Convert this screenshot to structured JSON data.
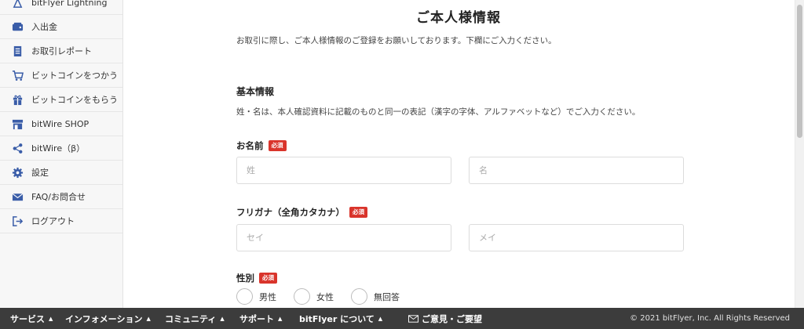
{
  "sidebar": {
    "items": [
      {
        "label": "bitFlyer Lightning",
        "icon": "lightning-icon"
      },
      {
        "label": "入出金",
        "icon": "wallet-icon"
      },
      {
        "label": "お取引レポート",
        "icon": "report-icon"
      },
      {
        "label": "ビットコインをつかう",
        "icon": "cart-icon"
      },
      {
        "label": "ビットコインをもらう",
        "icon": "gift-icon"
      },
      {
        "label": "bitWire SHOP",
        "icon": "shop-icon"
      },
      {
        "label": "bitWire（β）",
        "icon": "share-icon"
      },
      {
        "label": "設定",
        "icon": "gear-icon"
      },
      {
        "label": "FAQ/お問合せ",
        "icon": "mail-icon"
      },
      {
        "label": "ログアウト",
        "icon": "logout-icon"
      }
    ]
  },
  "main": {
    "title": "ご本人様情報",
    "lead": "お取引に際し、ご本人様情報のご登録をお願いしております。下欄にご入力ください。",
    "basic": {
      "title": "基本情報",
      "note": "姓・名は、本人確認資料に記載のものと同一の表記（漢字の字体、アルファベットなど）でご入力ください。"
    },
    "name": {
      "label": "お名前",
      "required": "必須",
      "last_placeholder": "姓",
      "first_placeholder": "名"
    },
    "kana": {
      "label": "フリガナ（全角カタカナ）",
      "required": "必須",
      "last_placeholder": "セイ",
      "first_placeholder": "メイ"
    },
    "gender": {
      "label": "性別",
      "required": "必須",
      "options": [
        "男性",
        "女性",
        "無回答"
      ]
    }
  },
  "footer": {
    "menu": [
      {
        "label": "サービス",
        "caret": "▲"
      },
      {
        "label": "インフォメーション",
        "caret": "▲"
      },
      {
        "label": "コミュニティ",
        "caret": "▲"
      },
      {
        "label": "サポート",
        "caret": "▲"
      },
      {
        "label": "bitFlyer について",
        "caret": "▲"
      }
    ],
    "feedback": "ご意見・ご要望",
    "copyright": "© 2021 bitFlyer, Inc. All Rights Reserved"
  },
  "colors": {
    "accent": "#3a5da8",
    "required_badge": "#d9342b",
    "footer_bg": "#3c3c3c"
  }
}
